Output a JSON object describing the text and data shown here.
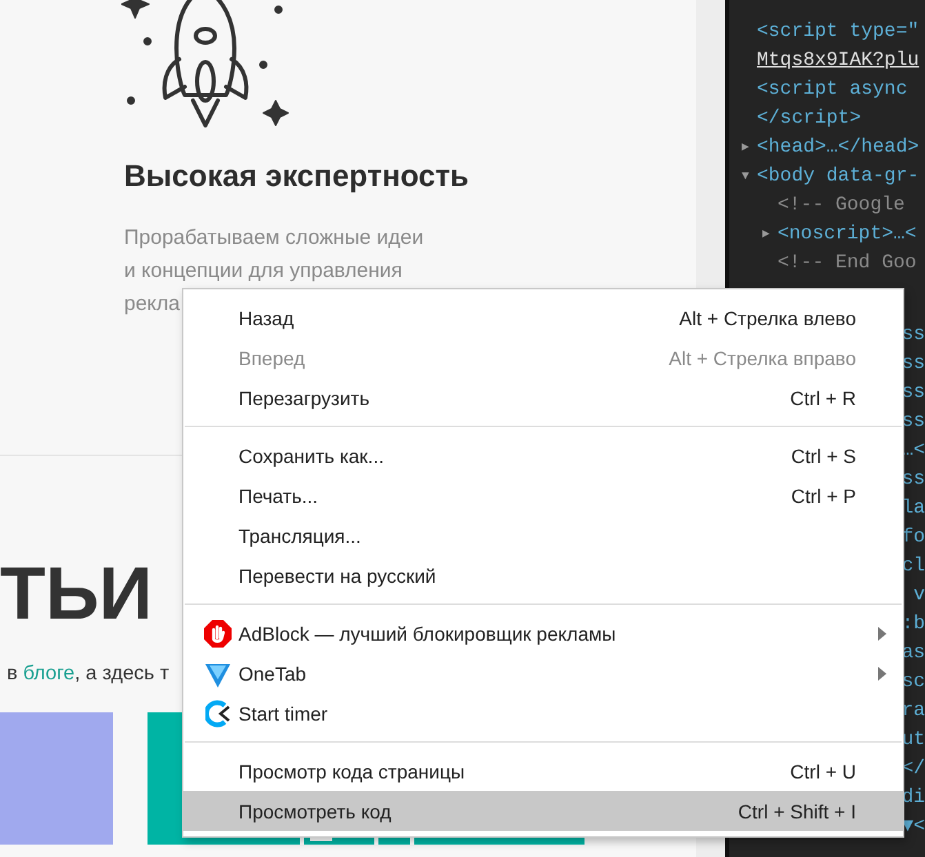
{
  "feature": {
    "title": "Высокая экспертность",
    "description_lines": [
      "Прорабатываем сложные идеи",
      "и концепции для управления",
      "рекла"
    ]
  },
  "articles": {
    "heading": "ТЬИ",
    "intro_before": "в ",
    "intro_link": "блоге",
    "intro_after": ", а здесь т",
    "cards": [
      {
        "color": "#a0a9ee"
      },
      {
        "color": "#00b4a4"
      }
    ]
  },
  "devtools": {
    "lines": [
      {
        "kind": "tag",
        "text": "<script type=\""
      },
      {
        "kind": "url",
        "text": "Mtqs8x9IAK?plu"
      },
      {
        "kind": "tag",
        "text": "<script async"
      },
      {
        "kind": "tag",
        "text": "</script>"
      },
      {
        "kind": "tag",
        "text": "<head>…</head>",
        "toggle": "▶"
      },
      {
        "kind": "tag",
        "text": "<body data-gr-",
        "toggle": "▼",
        "children": [
          {
            "kind": "comment",
            "text": "<!-- Google"
          },
          {
            "kind": "tag",
            "text": "<noscript>…<",
            "toggle": "▶"
          },
          {
            "kind": "comment",
            "text": "<!-- End Goo"
          }
        ]
      }
    ],
    "tail_fragments": [
      "ss",
      "ss",
      "ss",
      "ss",
      "…<",
      "ss",
      "la",
      "fo",
      "cl",
      "v",
      ":b",
      "as",
      "sc",
      "ra",
      "ut",
      "</",
      "di",
      "▼<"
    ]
  },
  "context_menu": {
    "items": [
      {
        "kind": "item",
        "label": "Назад",
        "shortcut": "Alt + Стрелка влево",
        "disabled": false,
        "selected": false
      },
      {
        "kind": "item",
        "label": "Вперед",
        "shortcut": "Alt + Стрелка вправо",
        "disabled": true,
        "selected": false
      },
      {
        "kind": "item",
        "label": "Перезагрузить",
        "shortcut": "Ctrl + R",
        "disabled": false,
        "selected": false
      },
      {
        "kind": "separator"
      },
      {
        "kind": "item",
        "label": "Сохранить как...",
        "shortcut": "Ctrl + S",
        "disabled": false,
        "selected": false
      },
      {
        "kind": "item",
        "label": "Печать...",
        "shortcut": "Ctrl + P",
        "disabled": false,
        "selected": false
      },
      {
        "kind": "item",
        "label": "Трансляция...",
        "disabled": false,
        "selected": false
      },
      {
        "kind": "item",
        "label": "Перевести на русский",
        "disabled": false,
        "selected": false
      },
      {
        "kind": "separator"
      },
      {
        "kind": "extension",
        "label": "AdBlock — лучший блокировщик рекламы",
        "submenu": true,
        "disabled": false,
        "selected": false
      },
      {
        "kind": "extension",
        "label": "OneTab",
        "submenu": true,
        "disabled": false,
        "selected": false
      },
      {
        "kind": "extension",
        "label": "Start timer",
        "disabled": false,
        "selected": false
      },
      {
        "kind": "separator"
      },
      {
        "kind": "item",
        "label": "Просмотр кода страницы",
        "shortcut": "Ctrl + U",
        "disabled": false,
        "selected": false
      },
      {
        "kind": "item",
        "label": "Просмотреть код",
        "shortcut": "Ctrl + Shift + I",
        "disabled": false,
        "selected": true
      }
    ]
  }
}
